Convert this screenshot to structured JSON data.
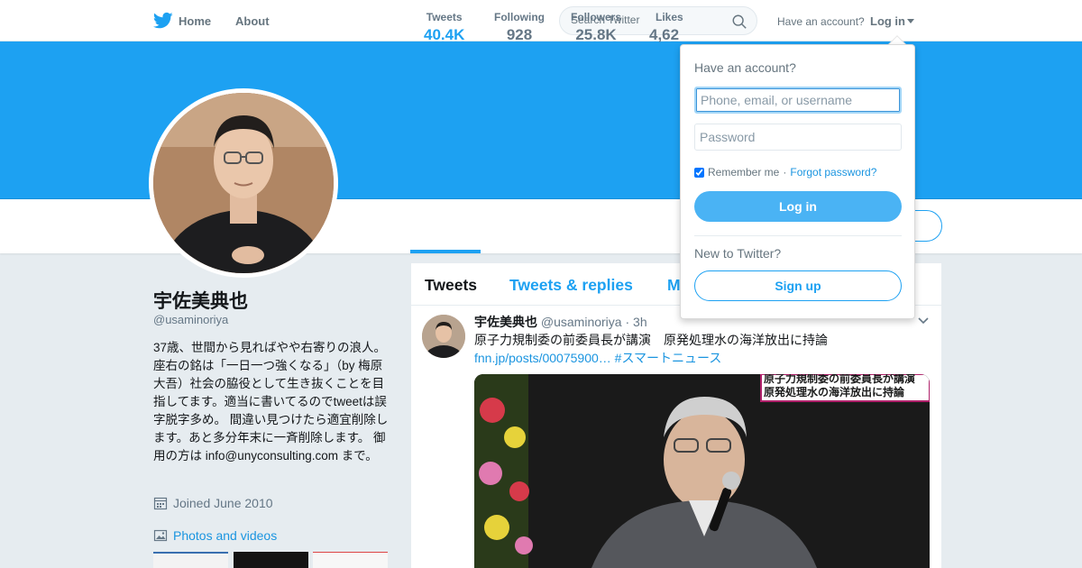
{
  "topbar": {
    "home_label": "Home",
    "about_label": "About",
    "search_placeholder": "Search Twitter",
    "have_account": "Have an account?",
    "login_label": "Log in"
  },
  "profile": {
    "name": "宇佐美典也",
    "handle": "@usaminoriya",
    "bio": "37歳、世間から見ればやや右寄りの浪人。 座右の銘は「一日一つ強くなる」（by 梅原大吾）社会の脇役として生き抜くことを目指してます。適当に書いてるのでtweetは誤字脱字多め。 間違い見つけたら適宜削除します。あと多分年末に一斉削除します。 御用の方は info@unyconsulting.com まで。",
    "joined": "Joined June 2010",
    "photos_label": "Photos and videos"
  },
  "stats": [
    {
      "label": "Tweets",
      "value": "40.4K"
    },
    {
      "label": "Following",
      "value": "928"
    },
    {
      "label": "Followers",
      "value": "25.8K"
    },
    {
      "label": "Likes",
      "value": "4,62"
    }
  ],
  "timeline": {
    "tabs": [
      "Tweets",
      "Tweets & replies",
      "M"
    ],
    "tweet": {
      "name": "宇佐美典也",
      "handle": "@usaminoriya",
      "time": "3h",
      "text": "原子力規制委の前委員長が講演　原発処理水の海洋放出に持論",
      "link": "fnn.jp/posts/00075900…",
      "hashtag": "#スマートニュース",
      "media_caption_line1": "原子力規制委の前委員長が講演",
      "media_caption_line2": "原発処理水の海洋放出に持論"
    }
  },
  "login_dropdown": {
    "title": "Have an account?",
    "username_placeholder": "Phone, email, or username",
    "password_placeholder": "Password",
    "remember_label": "Remember me",
    "separator": "·",
    "forgot_label": "Forgot password?",
    "login_button": "Log in",
    "new_label": "New to Twitter?",
    "signup_button": "Sign up"
  },
  "colors": {
    "brand": "#1da1f2",
    "link": "#1b95e0",
    "login_button": "#4ab3f4",
    "background": "#e6ecf0"
  },
  "icons": [
    "twitter-bird-icon",
    "search-icon",
    "caret-down-icon",
    "calendar-icon",
    "photo-icon",
    "chevron-down-icon"
  ]
}
